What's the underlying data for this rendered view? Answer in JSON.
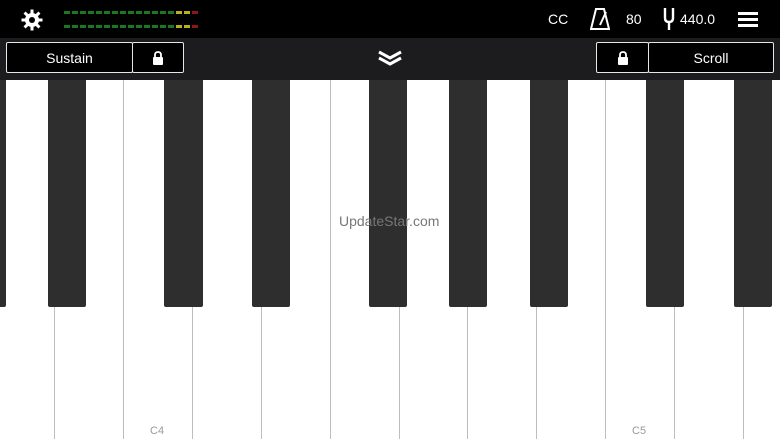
{
  "topbar": {
    "cc_label": "CC",
    "tempo": "80",
    "tuning": "440.0"
  },
  "controls": {
    "sustain_label": "Sustain",
    "scroll_label": "Scroll"
  },
  "keyboard": {
    "labels": [
      "C4",
      "C5"
    ]
  },
  "watermark": "UpdateStar.com",
  "icons": [
    "gear-icon",
    "level-meter",
    "metronome-icon",
    "tuning-fork-icon",
    "menu-icon",
    "lock-icon",
    "collapse-chevron-icon"
  ],
  "colors": {
    "background": "#000000",
    "toolbar": "#1c1c1e",
    "black_key": "#2e2e2e",
    "white_key": "#ffffff",
    "meter_green": "#1a7a22",
    "meter_yellow": "#b8b020",
    "meter_red": "#8a1a14"
  }
}
